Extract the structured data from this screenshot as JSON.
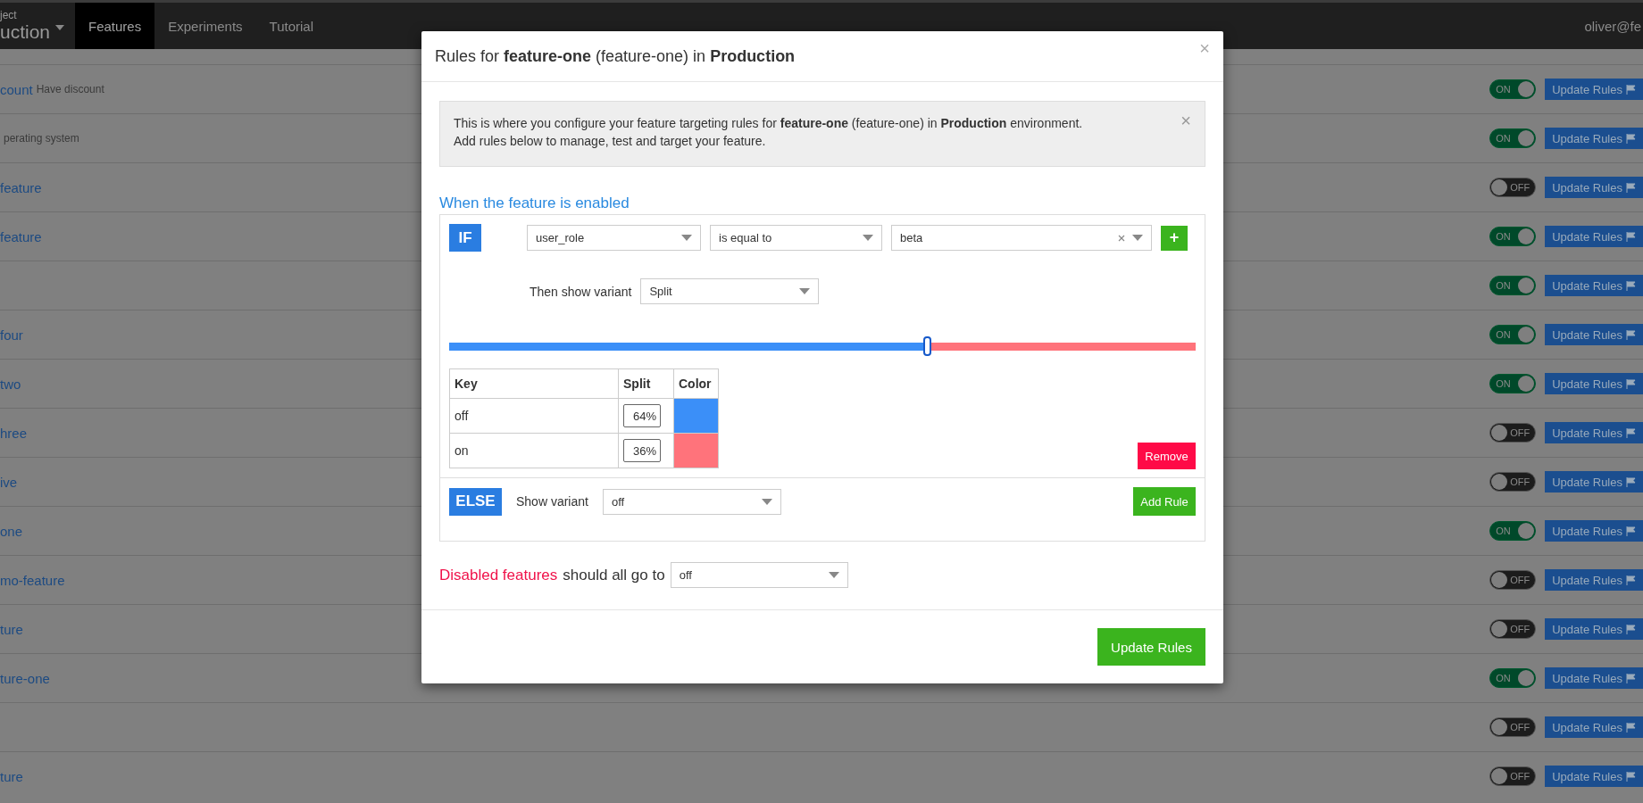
{
  "navbar": {
    "project_label": "ject",
    "project_name": "uction",
    "tabs": [
      {
        "label": "Features",
        "selected": true
      },
      {
        "label": "Experiments",
        "selected": false
      },
      {
        "label": "Tutorial",
        "selected": false
      }
    ],
    "user": "oliver@fe"
  },
  "features": [
    {
      "name": "count",
      "description": "Have discount",
      "on": true,
      "toggle_label": "ON",
      "button": "Update Rules"
    },
    {
      "description": "perating system",
      "on": true,
      "toggle_label": "ON",
      "button": "Update Rules"
    },
    {
      "name": "feature",
      "on": false,
      "toggle_label": "OFF",
      "button": "Update Rules"
    },
    {
      "name": "feature",
      "on": true,
      "toggle_label": "ON",
      "button": "Update Rules"
    },
    {
      "on": true,
      "toggle_label": "ON",
      "button": "Update Rules"
    },
    {
      "name": "four",
      "on": true,
      "toggle_label": "ON",
      "button": "Update Rules"
    },
    {
      "name": "two",
      "on": true,
      "toggle_label": "ON",
      "button": "Update Rules"
    },
    {
      "name": "hree",
      "on": false,
      "toggle_label": "OFF",
      "button": "Update Rules"
    },
    {
      "name": "ive",
      "on": false,
      "toggle_label": "OFF",
      "button": "Update Rules"
    },
    {
      "name": "one",
      "on": true,
      "toggle_label": "ON",
      "button": "Update Rules"
    },
    {
      "name": "mo-feature",
      "on": false,
      "toggle_label": "OFF",
      "button": "Update Rules"
    },
    {
      "name": "ture",
      "on": false,
      "toggle_label": "OFF",
      "button": "Update Rules"
    },
    {
      "name": "ture-one",
      "on": true,
      "toggle_label": "ON",
      "button": "Update Rules"
    },
    {
      "on": false,
      "toggle_label": "OFF",
      "button": "Update Rules"
    },
    {
      "name": "ture",
      "on": false,
      "toggle_label": "OFF",
      "button": "Update Rules"
    }
  ],
  "modal": {
    "title": "Rules for **feature-one** (feature-one) in **Production**",
    "close": "×",
    "alert": {
      "lines": [
        "This is where you configure your feature targeting rules for **feature-one** (feature-one) in **Production** environment.",
        "Add rules below to manage, test and target your feature."
      ],
      "close": "×"
    },
    "section_title": "When the feature is enabled",
    "rule": {
      "if_label": "IF",
      "condition": {
        "attribute": "user_role",
        "operator": "is equal to",
        "value": "beta"
      },
      "add_condition": "+",
      "then_label": "Then show variant",
      "variant": "Split",
      "split": {
        "level": 0.64,
        "columns": [
          "Key",
          "Split",
          "Color"
        ],
        "rows": [
          {
            "key": "off",
            "split": "64%",
            "color": "#3b8ff8"
          },
          {
            "key": "on",
            "split": "36%",
            "color": "#ff737b"
          }
        ]
      },
      "remove": "Remove",
      "else_label": "ELSE",
      "else_text": "Show variant",
      "else_variant": "off",
      "add_rule": "Add Rule"
    },
    "disabled": {
      "highlight": "Disabled features",
      "text": "should all go to",
      "value": "off"
    },
    "submit": "Update Rules"
  }
}
